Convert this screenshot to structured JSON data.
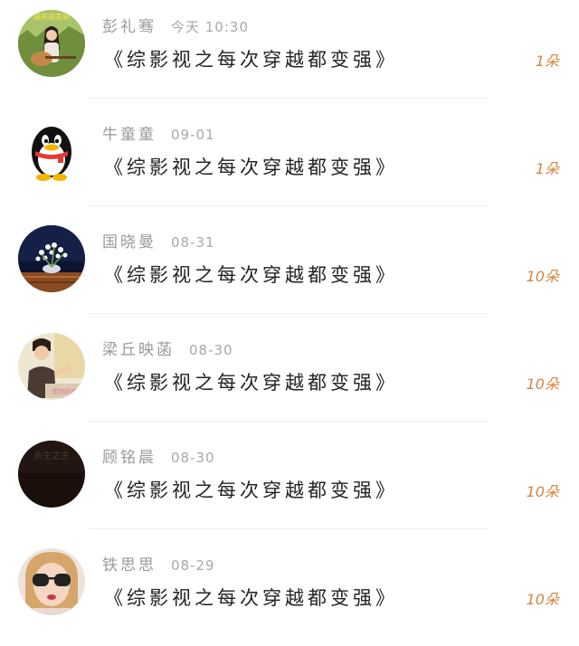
{
  "items": [
    {
      "name": "彭礼骞",
      "date": "今天 10:30",
      "title": "《综影视之每次穿越都变强》",
      "count": "1朵",
      "avatar_icon": "guitar-girl-avatar",
      "avatar_text": "越来越美丽"
    },
    {
      "name": "牛童童",
      "date": "09-01",
      "title": "《综影视之每次穿越都变强》",
      "count": "1朵",
      "avatar_icon": "penguin-avatar"
    },
    {
      "name": "国晓曼",
      "date": "08-31",
      "title": "《综影视之每次穿越都变强》",
      "count": "10朵",
      "avatar_icon": "flower-vase-avatar"
    },
    {
      "name": "梁丘映菡",
      "date": "08-30",
      "title": "《综影视之每次穿越都变强》",
      "count": "10朵",
      "avatar_icon": "young-man-avatar",
      "avatar_text": "想你的夜"
    },
    {
      "name": "顾铭晨",
      "date": "08-30",
      "title": "《综影视之每次穿越都变强》",
      "count": "10朵",
      "avatar_icon": "dark-text-avatar",
      "avatar_text": "余生之主"
    },
    {
      "name": "铁思思",
      "date": "08-29",
      "title": "《综影视之每次穿越都变强》",
      "count": "10朵",
      "avatar_icon": "sunglasses-girl-avatar"
    }
  ],
  "colors": {
    "count": "#d4843c",
    "name": "#9a9a9a",
    "title": "#222222",
    "divider": "#eeeeee"
  }
}
